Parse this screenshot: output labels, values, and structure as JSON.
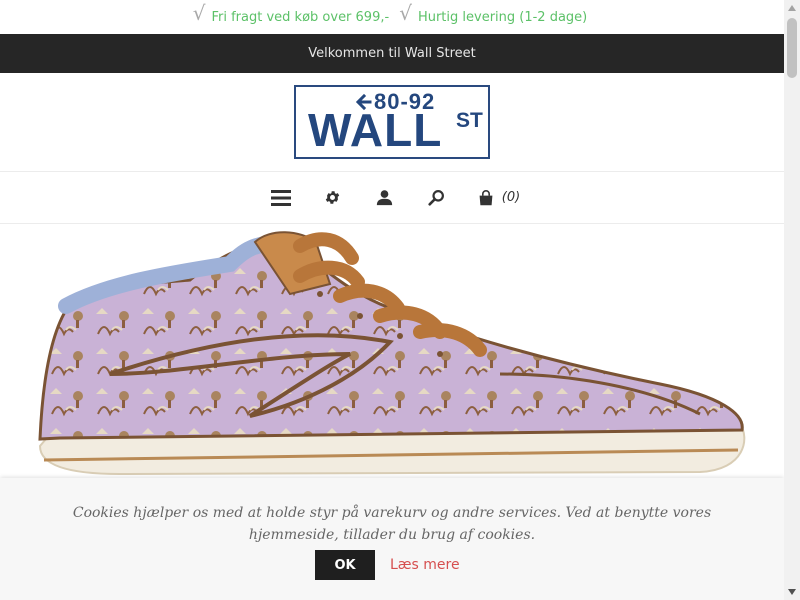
{
  "promo": {
    "items": [
      {
        "text": "Fri fragt ved køb over 699,-",
        "icon": "check-icon"
      },
      {
        "text": "Hurtig levering (1-2 dage)",
        "icon": "check-icon"
      }
    ],
    "color": "#5cc168"
  },
  "welcome": {
    "text": "Velkommen til Wall Street",
    "background": "#262626"
  },
  "logo": {
    "number": "80-92",
    "main": "WALL",
    "suffix": "ST",
    "color": "#24477e"
  },
  "nav": {
    "icons": [
      "menu-icon",
      "gear-icon",
      "user-icon",
      "search-icon",
      "cart-icon"
    ],
    "cart_count": "(0)"
  },
  "hero": {
    "subject": "sneaker-image"
  },
  "cookie": {
    "text": "Cookies hjælper os med at holde styr på varekurv og andre services. Ved at benytte vores hjemmeside, tillader du brug af cookies.",
    "ok_label": "OK",
    "read_more_label": "Læs mere",
    "link_color": "#d64f4f"
  }
}
